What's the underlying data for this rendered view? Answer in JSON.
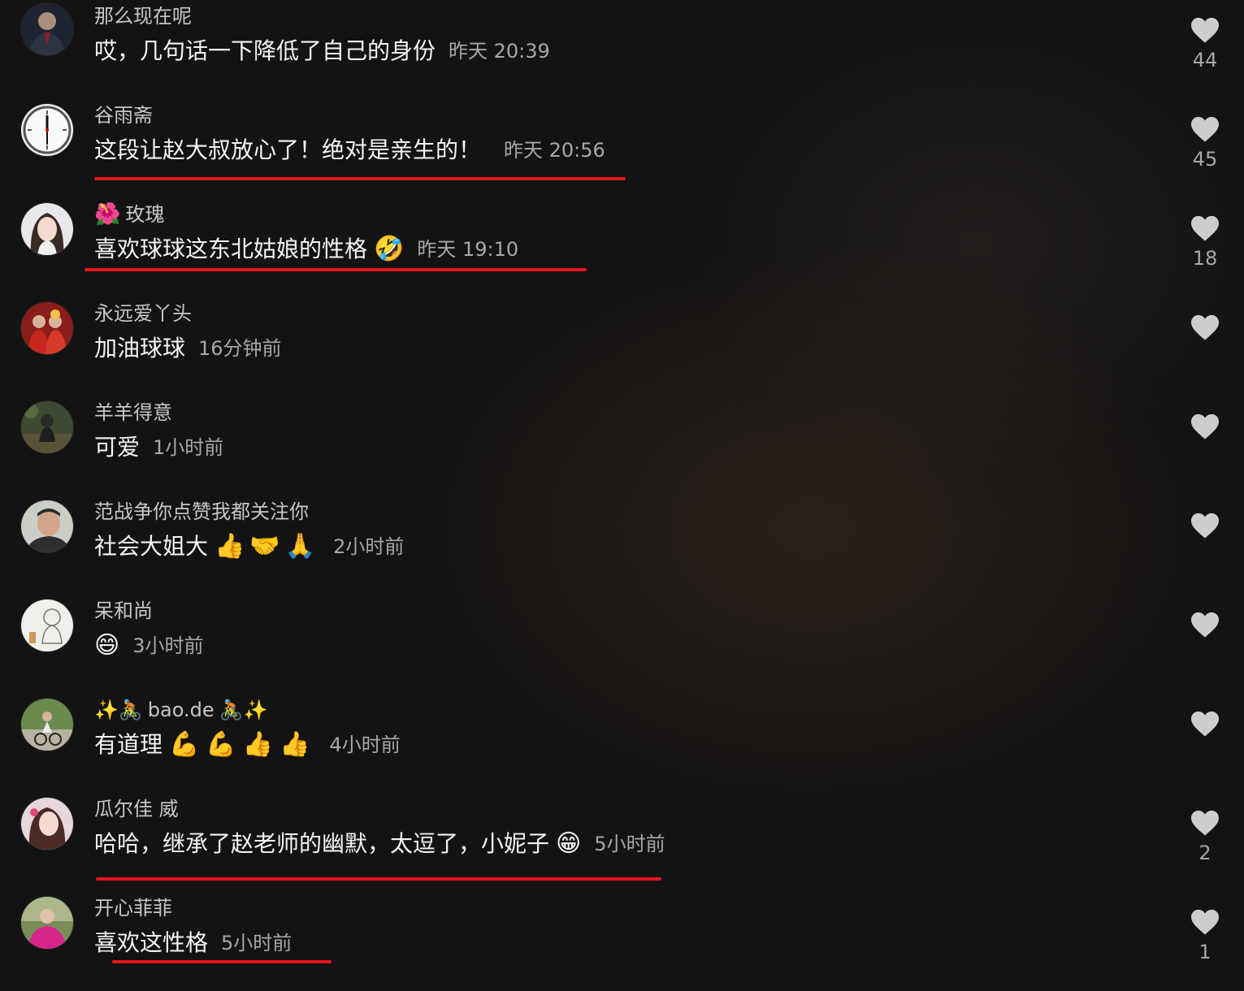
{
  "colors": {
    "background": "#141313",
    "underline": "#e3161c",
    "like_icon": "#cfcccc"
  },
  "comments": [
    {
      "username": "那么现在呢",
      "prefix": "",
      "suffix": "",
      "text": "哎，几句话一下降低了自己的身份",
      "emoji": "",
      "time": "昨天 20:39",
      "likes": "44",
      "avatar_icon": "man-in-suit-avatar"
    },
    {
      "username": "谷雨斋",
      "prefix": "",
      "suffix": "",
      "text": "这段让赵大叔放心了！绝对是亲生的！",
      "emoji": "",
      "time": "昨天 20:56",
      "likes": "45",
      "avatar_icon": "clock-avatar"
    },
    {
      "username": "玫瑰",
      "prefix": "🌺",
      "suffix": "",
      "text": "喜欢球球这东北姑娘的性格",
      "emoji": "🤣",
      "time": "昨天 19:10",
      "likes": "18",
      "avatar_icon": "woman-portrait-avatar"
    },
    {
      "username": "永远爱丫头",
      "prefix": "",
      "suffix": "",
      "text": "加油球球",
      "emoji": "",
      "time": "16分钟前",
      "likes": "",
      "avatar_icon": "wedding-couple-avatar"
    },
    {
      "username": "羊羊得意",
      "prefix": "",
      "suffix": "",
      "text": "可爱",
      "emoji": "",
      "time": "1小时前",
      "likes": "",
      "avatar_icon": "outdoor-child-avatar"
    },
    {
      "username": "范战争你点赞我都关注你",
      "prefix": "",
      "suffix": "",
      "text": "社会大姐大",
      "emoji": "👍🤝🙏",
      "time": "2小时前",
      "likes": "",
      "avatar_icon": "man-portrait-avatar"
    },
    {
      "username": "呆和尚",
      "prefix": "",
      "suffix": "",
      "text": "",
      "emoji": "😄",
      "time": "3小时前",
      "likes": "",
      "avatar_icon": "monk-drawing-avatar"
    },
    {
      "username": "bao.de",
      "prefix": "✨🚴",
      "suffix": "🚴✨",
      "text": "有道理",
      "emoji": "💪💪👍👍",
      "time": "4小时前",
      "likes": "",
      "avatar_icon": "cyclist-avatar"
    },
    {
      "username": "瓜尔佳 威",
      "prefix": "",
      "suffix": "",
      "text": "哈哈，继承了赵老师的幽默，太逗了，小妮子",
      "emoji": "😁",
      "time": "5小时前",
      "likes": "2",
      "avatar_icon": "woman-selfie-avatar"
    },
    {
      "username": "开心菲菲",
      "prefix": "",
      "suffix": "",
      "text": "喜欢这性格",
      "emoji": "",
      "time": "5小时前",
      "likes": "1",
      "avatar_icon": "woman-pink-jacket-avatar"
    }
  ]
}
